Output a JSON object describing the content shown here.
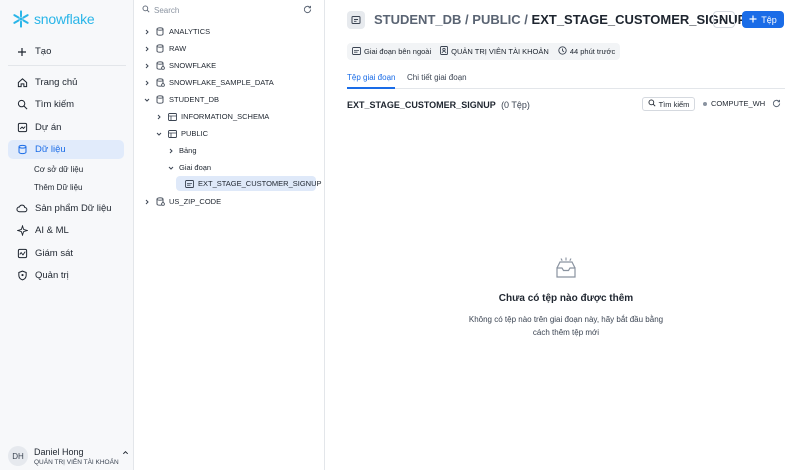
{
  "brand": {
    "name": "snowflake",
    "color": "#29b5e8"
  },
  "nav": {
    "create": "Tạo",
    "items": [
      {
        "label": "Trang chủ",
        "icon": "home-icon"
      },
      {
        "label": "Tìm kiếm",
        "icon": "search-icon"
      },
      {
        "label": "Dự án",
        "icon": "projects-icon"
      },
      {
        "label": "Dữ liệu",
        "icon": "database-icon",
        "active": true
      },
      {
        "label": "Sản phẩm Dữ liệu",
        "icon": "cloud-icon"
      },
      {
        "label": "AI & ML",
        "icon": "sparkle-icon"
      },
      {
        "label": "Giám sát",
        "icon": "monitor-icon"
      },
      {
        "label": "Quản trị",
        "icon": "shield-icon"
      }
    ],
    "sub_items": [
      "Cơ sở dữ liệu",
      "Thêm Dữ liệu"
    ]
  },
  "user": {
    "initials": "DH",
    "name": "Daniel Hong",
    "role": "QUẢN TRỊ VIÊN TÀI KHOẢN"
  },
  "tree": {
    "search_placeholder": "Search",
    "nodes": [
      {
        "label": "ANALYTICS"
      },
      {
        "label": "RAW"
      },
      {
        "label": "SNOWFLAKE"
      },
      {
        "label": "SNOWFLAKE_SAMPLE_DATA"
      },
      {
        "label": "STUDENT_DB"
      },
      {
        "label": "INFORMATION_SCHEMA"
      },
      {
        "label": "PUBLIC"
      },
      {
        "label": "Bảng"
      },
      {
        "label": "Giai đoạn"
      },
      {
        "label": "EXT_STAGE_CUSTOMER_SIGNUP"
      },
      {
        "label": "US_ZIP_CODE"
      }
    ]
  },
  "header": {
    "crumb_db": "STUDENT_DB",
    "sep": "/",
    "crumb_schema": "PUBLIC",
    "crumb_stage": "EXT_STAGE_CUSTOMER_SIGNUP",
    "more": "···",
    "file_button": "Tệp",
    "accent": "#1a6ce7"
  },
  "chips": {
    "type": "Giai đoạn bên ngoài",
    "owner": "QUẢN TRỊ VIÊN TÀI KHOẢN",
    "time": "44 phút trước"
  },
  "tabs": [
    "Tệp giai đoạn",
    "Chi tiết giai đoạn"
  ],
  "files": {
    "title": "EXT_STAGE_CUSTOMER_SIGNUP",
    "count": "(0 Tệp)",
    "search": "Tìm kiếm",
    "warehouse": "COMPUTE_WH"
  },
  "empty": {
    "title": "Chưa có tệp nào được thêm",
    "desc": "Không có tệp nào trên giai đoạn này, hãy bắt đầu bằng cách thêm tệp mới"
  }
}
